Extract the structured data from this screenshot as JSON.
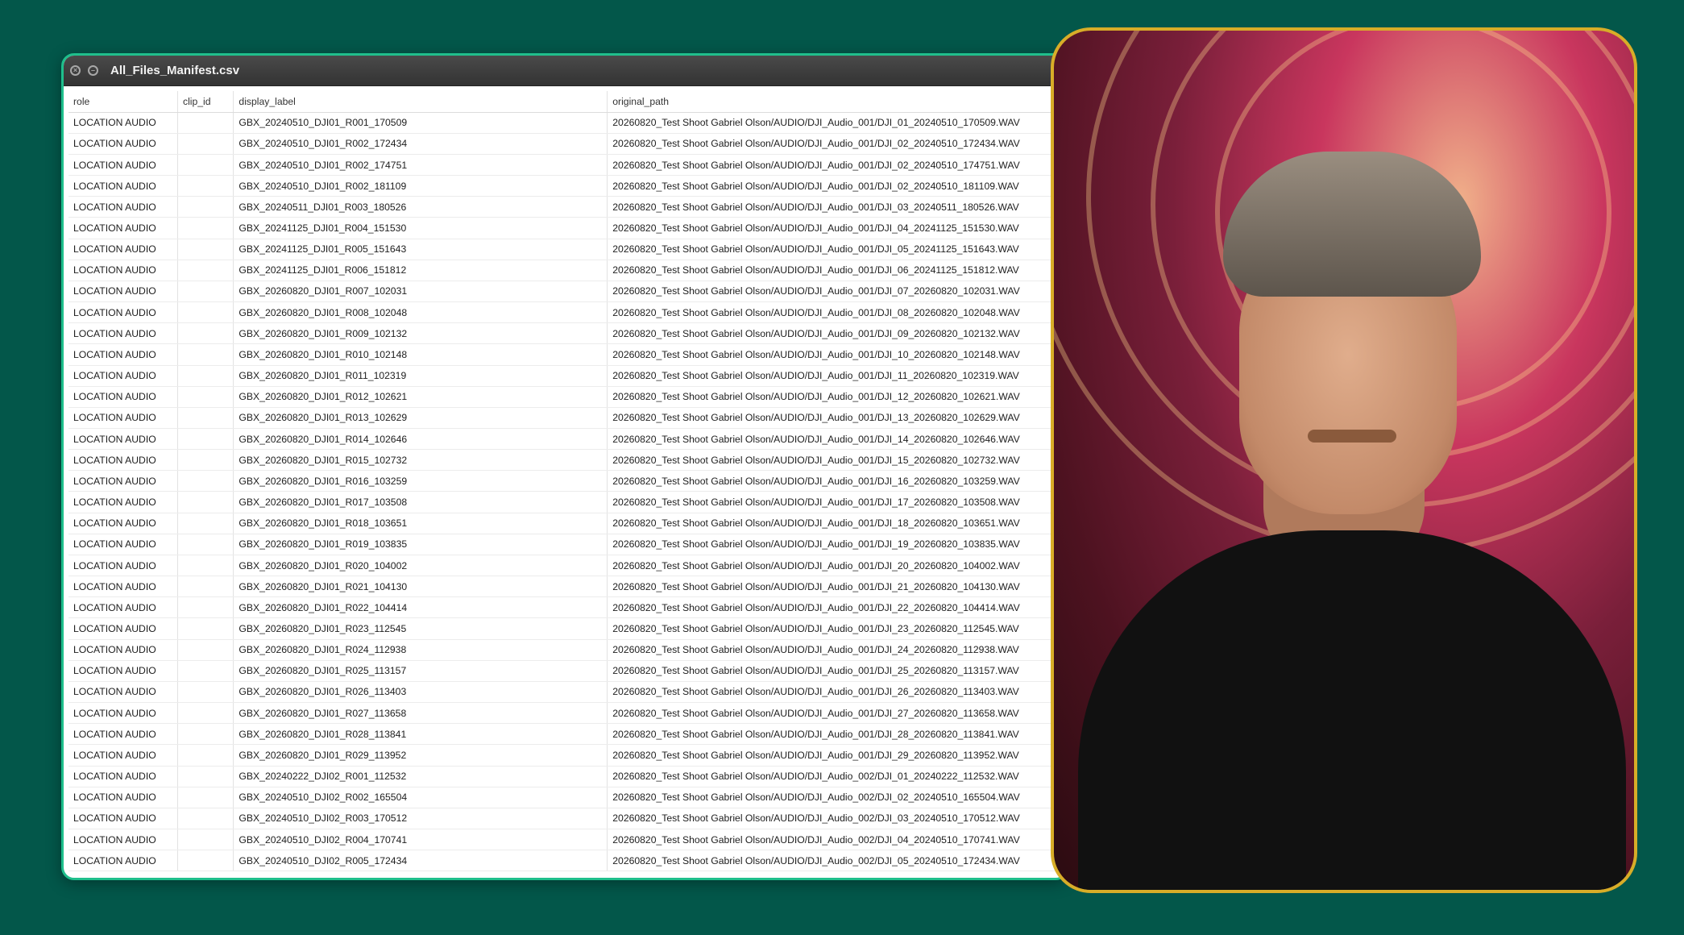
{
  "window": {
    "title": "All_Files_Manifest.csv"
  },
  "table": {
    "headers": [
      "role",
      "clip_id",
      "display_label",
      "original_path"
    ],
    "rows": [
      [
        "LOCATION AUDIO",
        "",
        "GBX_20240510_DJI01_R001_170509",
        "20260820_Test Shoot Gabriel Olson/AUDIO/DJI_Audio_001/DJI_01_20240510_170509.WAV"
      ],
      [
        "LOCATION AUDIO",
        "",
        "GBX_20240510_DJI01_R002_172434",
        "20260820_Test Shoot Gabriel Olson/AUDIO/DJI_Audio_001/DJI_02_20240510_172434.WAV"
      ],
      [
        "LOCATION AUDIO",
        "",
        "GBX_20240510_DJI01_R002_174751",
        "20260820_Test Shoot Gabriel Olson/AUDIO/DJI_Audio_001/DJI_02_20240510_174751.WAV"
      ],
      [
        "LOCATION AUDIO",
        "",
        "GBX_20240510_DJI01_R002_181109",
        "20260820_Test Shoot Gabriel Olson/AUDIO/DJI_Audio_001/DJI_02_20240510_181109.WAV"
      ],
      [
        "LOCATION AUDIO",
        "",
        "GBX_20240511_DJI01_R003_180526",
        "20260820_Test Shoot Gabriel Olson/AUDIO/DJI_Audio_001/DJI_03_20240511_180526.WAV"
      ],
      [
        "LOCATION AUDIO",
        "",
        "GBX_20241125_DJI01_R004_151530",
        "20260820_Test Shoot Gabriel Olson/AUDIO/DJI_Audio_001/DJI_04_20241125_151530.WAV"
      ],
      [
        "LOCATION AUDIO",
        "",
        "GBX_20241125_DJI01_R005_151643",
        "20260820_Test Shoot Gabriel Olson/AUDIO/DJI_Audio_001/DJI_05_20241125_151643.WAV"
      ],
      [
        "LOCATION AUDIO",
        "",
        "GBX_20241125_DJI01_R006_151812",
        "20260820_Test Shoot Gabriel Olson/AUDIO/DJI_Audio_001/DJI_06_20241125_151812.WAV"
      ],
      [
        "LOCATION AUDIO",
        "",
        "GBX_20260820_DJI01_R007_102031",
        "20260820_Test Shoot Gabriel Olson/AUDIO/DJI_Audio_001/DJI_07_20260820_102031.WAV"
      ],
      [
        "LOCATION AUDIO",
        "",
        "GBX_20260820_DJI01_R008_102048",
        "20260820_Test Shoot Gabriel Olson/AUDIO/DJI_Audio_001/DJI_08_20260820_102048.WAV"
      ],
      [
        "LOCATION AUDIO",
        "",
        "GBX_20260820_DJI01_R009_102132",
        "20260820_Test Shoot Gabriel Olson/AUDIO/DJI_Audio_001/DJI_09_20260820_102132.WAV"
      ],
      [
        "LOCATION AUDIO",
        "",
        "GBX_20260820_DJI01_R010_102148",
        "20260820_Test Shoot Gabriel Olson/AUDIO/DJI_Audio_001/DJI_10_20260820_102148.WAV"
      ],
      [
        "LOCATION AUDIO",
        "",
        "GBX_20260820_DJI01_R011_102319",
        "20260820_Test Shoot Gabriel Olson/AUDIO/DJI_Audio_001/DJI_11_20260820_102319.WAV"
      ],
      [
        "LOCATION AUDIO",
        "",
        "GBX_20260820_DJI01_R012_102621",
        "20260820_Test Shoot Gabriel Olson/AUDIO/DJI_Audio_001/DJI_12_20260820_102621.WAV"
      ],
      [
        "LOCATION AUDIO",
        "",
        "GBX_20260820_DJI01_R013_102629",
        "20260820_Test Shoot Gabriel Olson/AUDIO/DJI_Audio_001/DJI_13_20260820_102629.WAV"
      ],
      [
        "LOCATION AUDIO",
        "",
        "GBX_20260820_DJI01_R014_102646",
        "20260820_Test Shoot Gabriel Olson/AUDIO/DJI_Audio_001/DJI_14_20260820_102646.WAV"
      ],
      [
        "LOCATION AUDIO",
        "",
        "GBX_20260820_DJI01_R015_102732",
        "20260820_Test Shoot Gabriel Olson/AUDIO/DJI_Audio_001/DJI_15_20260820_102732.WAV"
      ],
      [
        "LOCATION AUDIO",
        "",
        "GBX_20260820_DJI01_R016_103259",
        "20260820_Test Shoot Gabriel Olson/AUDIO/DJI_Audio_001/DJI_16_20260820_103259.WAV"
      ],
      [
        "LOCATION AUDIO",
        "",
        "GBX_20260820_DJI01_R017_103508",
        "20260820_Test Shoot Gabriel Olson/AUDIO/DJI_Audio_001/DJI_17_20260820_103508.WAV"
      ],
      [
        "LOCATION AUDIO",
        "",
        "GBX_20260820_DJI01_R018_103651",
        "20260820_Test Shoot Gabriel Olson/AUDIO/DJI_Audio_001/DJI_18_20260820_103651.WAV"
      ],
      [
        "LOCATION AUDIO",
        "",
        "GBX_20260820_DJI01_R019_103835",
        "20260820_Test Shoot Gabriel Olson/AUDIO/DJI_Audio_001/DJI_19_20260820_103835.WAV"
      ],
      [
        "LOCATION AUDIO",
        "",
        "GBX_20260820_DJI01_R020_104002",
        "20260820_Test Shoot Gabriel Olson/AUDIO/DJI_Audio_001/DJI_20_20260820_104002.WAV"
      ],
      [
        "LOCATION AUDIO",
        "",
        "GBX_20260820_DJI01_R021_104130",
        "20260820_Test Shoot Gabriel Olson/AUDIO/DJI_Audio_001/DJI_21_20260820_104130.WAV"
      ],
      [
        "LOCATION AUDIO",
        "",
        "GBX_20260820_DJI01_R022_104414",
        "20260820_Test Shoot Gabriel Olson/AUDIO/DJI_Audio_001/DJI_22_20260820_104414.WAV"
      ],
      [
        "LOCATION AUDIO",
        "",
        "GBX_20260820_DJI01_R023_112545",
        "20260820_Test Shoot Gabriel Olson/AUDIO/DJI_Audio_001/DJI_23_20260820_112545.WAV"
      ],
      [
        "LOCATION AUDIO",
        "",
        "GBX_20260820_DJI01_R024_112938",
        "20260820_Test Shoot Gabriel Olson/AUDIO/DJI_Audio_001/DJI_24_20260820_112938.WAV"
      ],
      [
        "LOCATION AUDIO",
        "",
        "GBX_20260820_DJI01_R025_113157",
        "20260820_Test Shoot Gabriel Olson/AUDIO/DJI_Audio_001/DJI_25_20260820_113157.WAV"
      ],
      [
        "LOCATION AUDIO",
        "",
        "GBX_20260820_DJI01_R026_113403",
        "20260820_Test Shoot Gabriel Olson/AUDIO/DJI_Audio_001/DJI_26_20260820_113403.WAV"
      ],
      [
        "LOCATION AUDIO",
        "",
        "GBX_20260820_DJI01_R027_113658",
        "20260820_Test Shoot Gabriel Olson/AUDIO/DJI_Audio_001/DJI_27_20260820_113658.WAV"
      ],
      [
        "LOCATION AUDIO",
        "",
        "GBX_20260820_DJI01_R028_113841",
        "20260820_Test Shoot Gabriel Olson/AUDIO/DJI_Audio_001/DJI_28_20260820_113841.WAV"
      ],
      [
        "LOCATION AUDIO",
        "",
        "GBX_20260820_DJI01_R029_113952",
        "20260820_Test Shoot Gabriel Olson/AUDIO/DJI_Audio_001/DJI_29_20260820_113952.WAV"
      ],
      [
        "LOCATION AUDIO",
        "",
        "GBX_20240222_DJI02_R001_112532",
        "20260820_Test Shoot Gabriel Olson/AUDIO/DJI_Audio_002/DJI_01_20240222_112532.WAV"
      ],
      [
        "LOCATION AUDIO",
        "",
        "GBX_20240510_DJI02_R002_165504",
        "20260820_Test Shoot Gabriel Olson/AUDIO/DJI_Audio_002/DJI_02_20240510_165504.WAV"
      ],
      [
        "LOCATION AUDIO",
        "",
        "GBX_20240510_DJI02_R003_170512",
        "20260820_Test Shoot Gabriel Olson/AUDIO/DJI_Audio_002/DJI_03_20240510_170512.WAV"
      ],
      [
        "LOCATION AUDIO",
        "",
        "GBX_20240510_DJI02_R004_170741",
        "20260820_Test Shoot Gabriel Olson/AUDIO/DJI_Audio_002/DJI_04_20240510_170741.WAV"
      ],
      [
        "LOCATION AUDIO",
        "",
        "GBX_20240510_DJI02_R005_172434",
        "20260820_Test Shoot Gabriel Olson/AUDIO/DJI_Audio_002/DJI_05_20240510_172434.WAV"
      ]
    ]
  },
  "icons": {
    "close": "close-icon",
    "minimize": "minimize-icon"
  },
  "colors": {
    "background": "#03574a",
    "window_border": "#1fbf8c",
    "webcam_border": "#d8ad28"
  }
}
